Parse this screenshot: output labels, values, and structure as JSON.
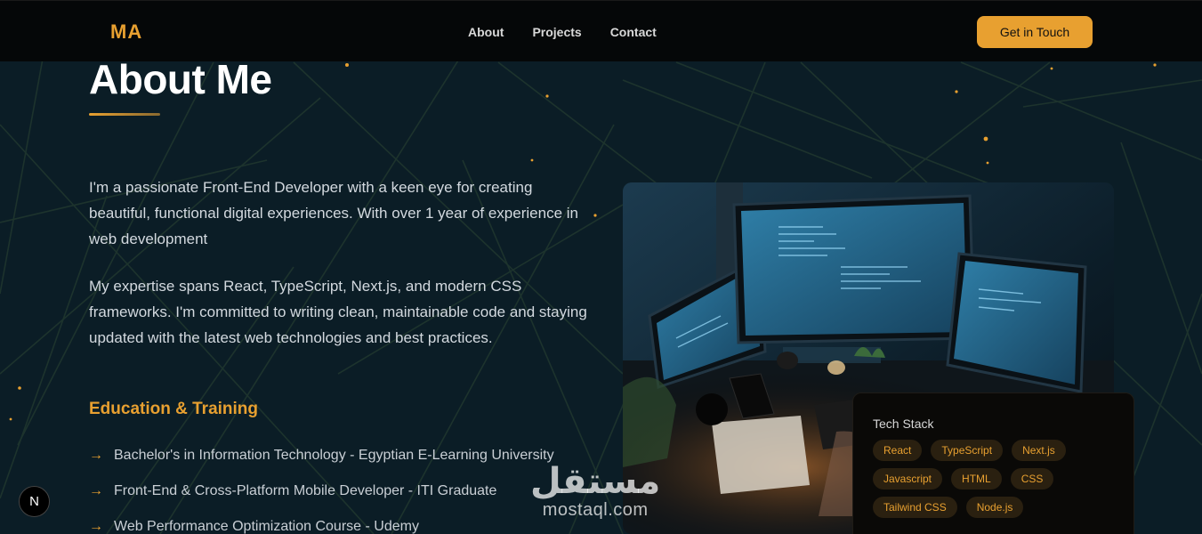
{
  "nav": {
    "logo": "MA",
    "links": [
      "About",
      "Projects",
      "Contact"
    ],
    "cta": "Get in Touch"
  },
  "about": {
    "title": "About Me",
    "paragraphs": [
      "I'm a passionate Front-End Developer with a keen eye for creating beautiful, functional digital experiences. With over 1 year of experience in web development",
      "My expertise spans React, TypeScript, Next.js, and modern CSS frameworks. I'm committed to writing clean, maintainable code and staying updated with the latest web technologies and best practices."
    ],
    "education_heading": "Education & Training",
    "education": [
      "Bachelor's in Information Technology - Egyptian E-Learning University",
      "Front-End & Cross-Platform Mobile Developer - ITI Graduate",
      "Web Performance Optimization Course - Udemy"
    ],
    "arrow_glyph": "→"
  },
  "tech_stack": {
    "title": "Tech Stack",
    "tags": [
      "React",
      "TypeScript",
      "Next.js",
      "Javascript",
      "HTML",
      "CSS",
      "Tailwind CSS",
      "Node.js"
    ]
  },
  "badge": {
    "label": "N"
  },
  "watermark": {
    "arabic": "مستقل",
    "latin": "mostaql.com"
  },
  "colors": {
    "accent": "#e8a030",
    "background": "#0b1d26",
    "navbar": "#050708",
    "card": "#0a0907"
  }
}
